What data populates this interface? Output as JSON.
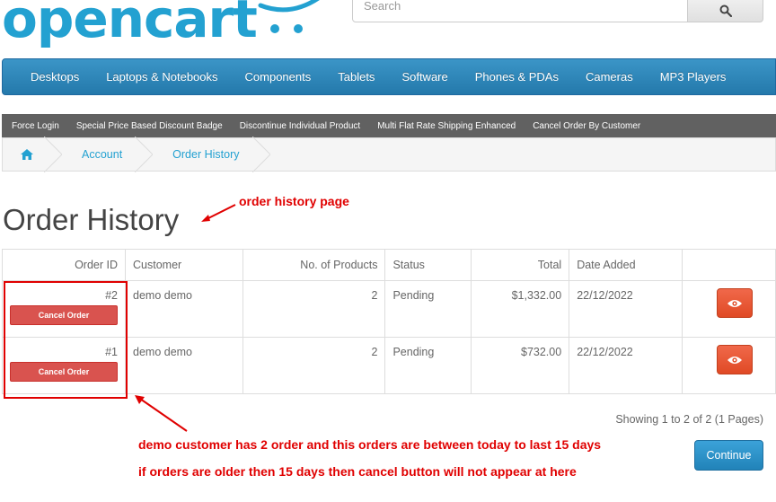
{
  "logo": {
    "text": "opencart"
  },
  "search": {
    "placeholder": "Search"
  },
  "menu": [
    "Desktops",
    "Laptops & Notebooks",
    "Components",
    "Tablets",
    "Software",
    "Phones & PDAs",
    "Cameras",
    "MP3 Players"
  ],
  "extensions": [
    "Force Login",
    "Special Price Based Discount Badge",
    "Discontinue Individual Product",
    "Multi Flat Rate Shipping Enhanced",
    "Cancel Order By Customer"
  ],
  "breadcrumb": {
    "account": "Account",
    "order_history": "Order History"
  },
  "page": {
    "title": "Order History"
  },
  "table": {
    "headers": {
      "order_id": "Order ID",
      "customer": "Customer",
      "products": "No. of Products",
      "status": "Status",
      "total": "Total",
      "date": "Date Added"
    },
    "rows": [
      {
        "order_id": "#2",
        "cancel_label": "Cancel Order",
        "customer": "demo demo",
        "products": "2",
        "status": "Pending",
        "total": "$1,332.00",
        "date": "22/12/2022"
      },
      {
        "order_id": "#1",
        "cancel_label": "Cancel Order",
        "customer": "demo demo",
        "products": "2",
        "status": "Pending",
        "total": "$732.00",
        "date": "22/12/2022"
      }
    ]
  },
  "pagination": {
    "text": "Showing 1 to 2 of 2 (1 Pages)"
  },
  "continue_label": "Continue",
  "annotations": {
    "page_note": "order history page",
    "demo_note": "demo customer has 2 order and this orders are between today to last 15 days",
    "rule_note": "if orders are older then 15 days then cancel button will not appear at here"
  },
  "colors": {
    "brand": "#23a1d1",
    "menu": "#2a85bb",
    "cancel": "#d9534f",
    "view": "#e5532f",
    "annotation": "#e00000"
  }
}
